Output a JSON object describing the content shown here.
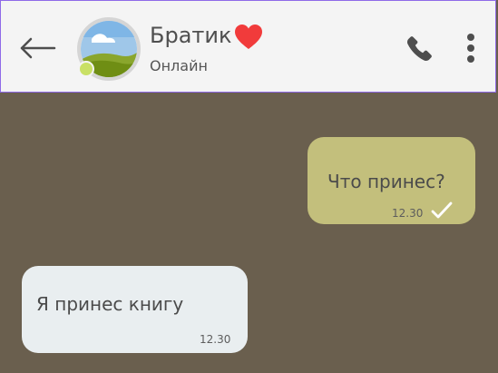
{
  "header": {
    "contact_name": "Братик",
    "status": "Онлайн"
  },
  "icons": {
    "back": "back-arrow-icon",
    "avatar": "avatar",
    "heart": "heart-icon",
    "call": "phone-icon",
    "menu": "more-vertical-icon",
    "delivered": "check-icon"
  },
  "messages": [
    {
      "direction": "outgoing",
      "text": "Что принес?",
      "time": "12.30",
      "delivered": true
    },
    {
      "direction": "incoming",
      "text": "Я принес книгу",
      "time": "12.30"
    }
  ],
  "colors": {
    "background": "#6a5f4e",
    "header_background": "#f4f4f4",
    "header_border": "#8f6ae8",
    "outgoing_bubble": "#c3bf7c",
    "incoming_bubble": "#e9eef0",
    "online_indicator": "#c9e065",
    "heart": "#f13b3b"
  }
}
